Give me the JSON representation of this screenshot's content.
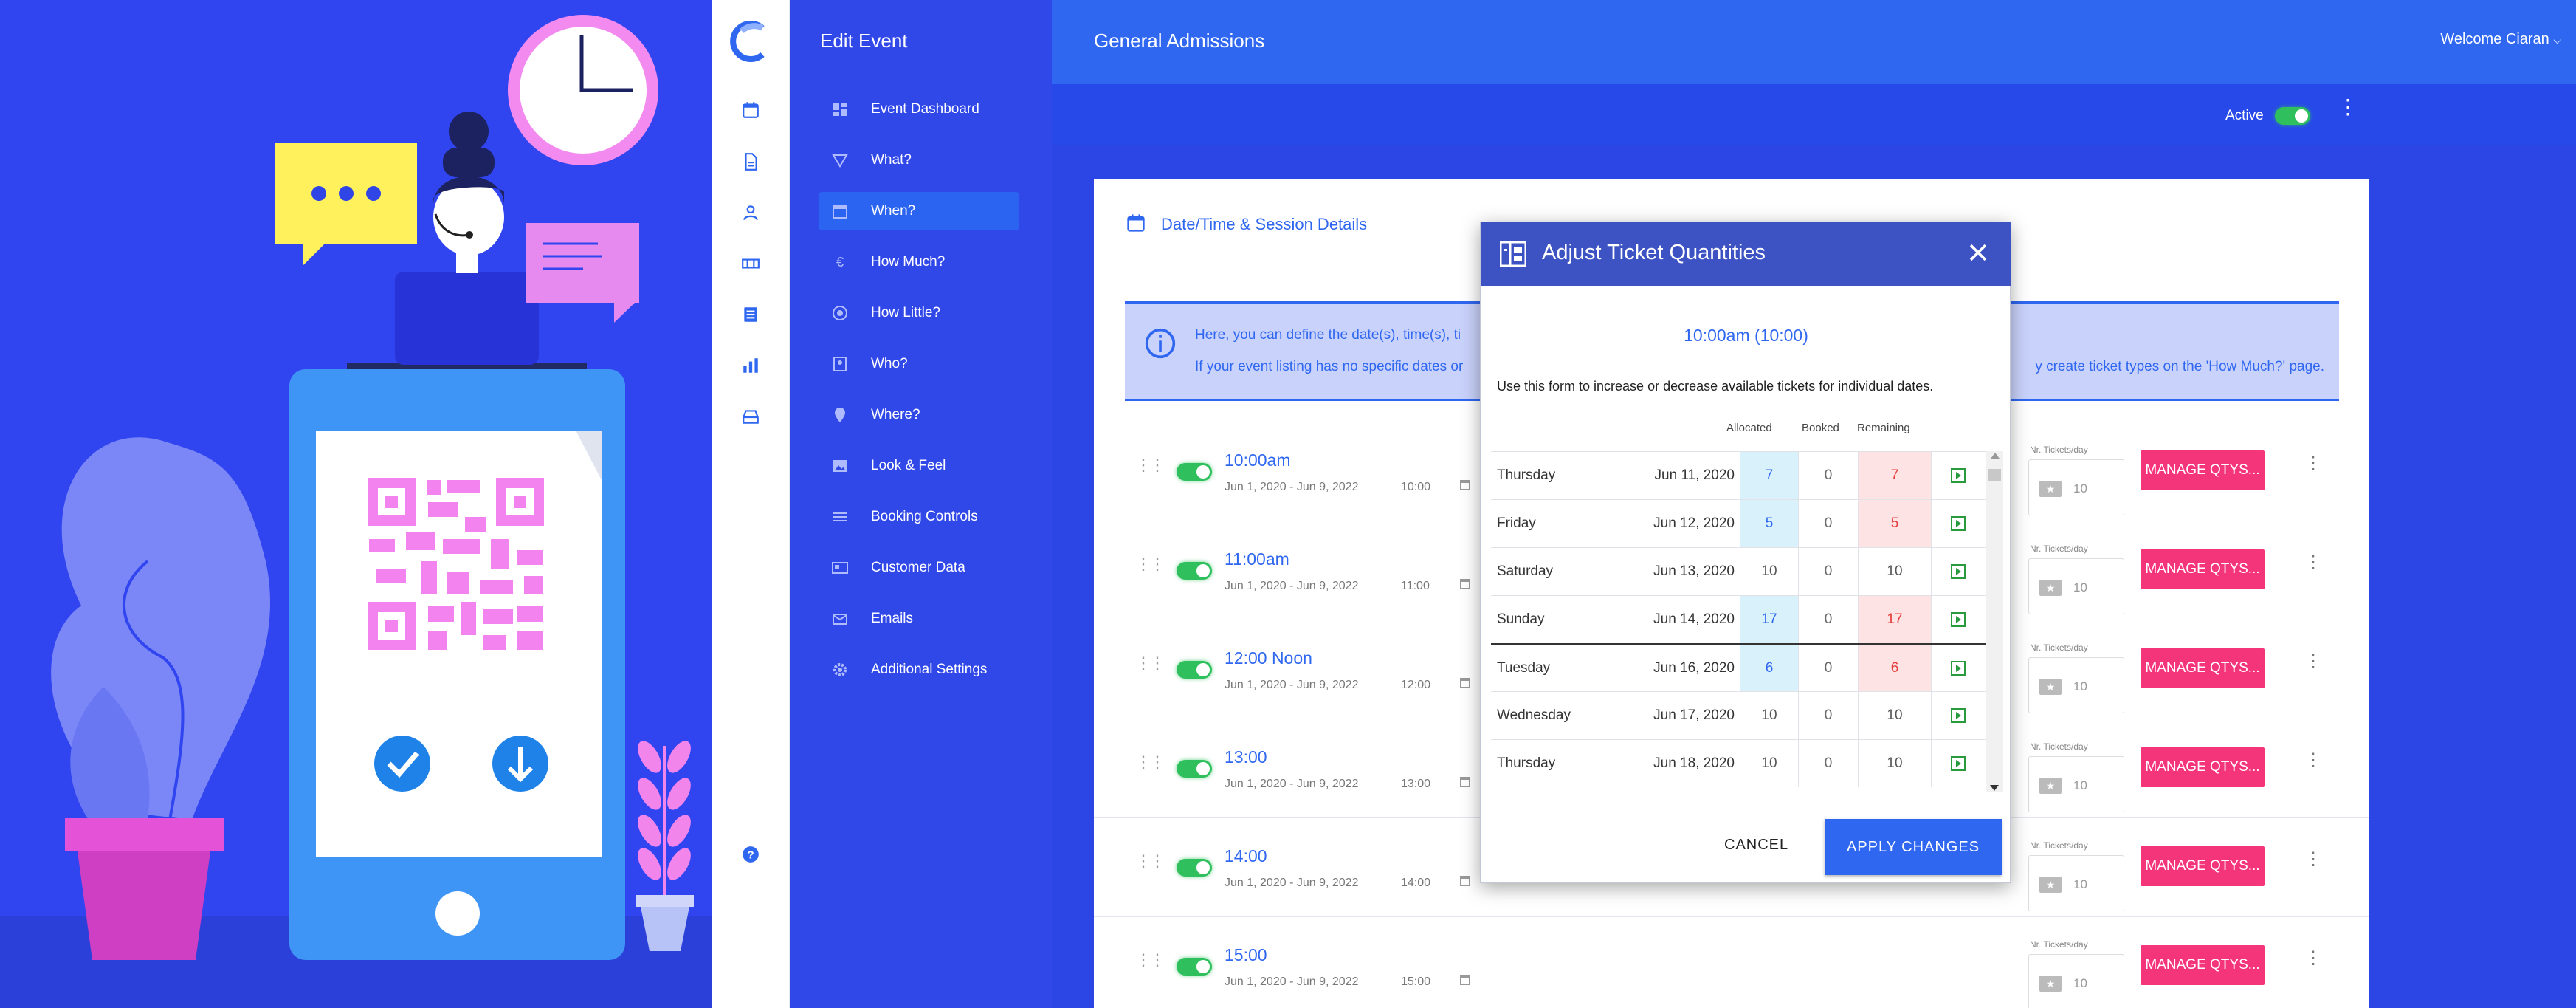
{
  "app": {
    "title": "General Admissions",
    "welcome": "Welcome Ciaran"
  },
  "nav": {
    "header": "Edit Event",
    "items": [
      {
        "label": "Event Dashboard",
        "icon": "dashboard-icon",
        "active": false
      },
      {
        "label": "What?",
        "icon": "triangle-icon",
        "active": false
      },
      {
        "label": "When?",
        "icon": "calendar-icon",
        "active": true
      },
      {
        "label": "How Much?",
        "icon": "euro-icon",
        "active": false
      },
      {
        "label": "How Little?",
        "icon": "badge-icon",
        "active": false
      },
      {
        "label": "Who?",
        "icon": "contact-icon",
        "active": false
      },
      {
        "label": "Where?",
        "icon": "pin-icon",
        "active": false
      },
      {
        "label": "Look & Feel",
        "icon": "image-icon",
        "active": false
      },
      {
        "label": "Booking Controls",
        "icon": "sliders-icon",
        "active": false
      },
      {
        "label": "Customer Data",
        "icon": "id-card-icon",
        "active": false
      },
      {
        "label": "Emails",
        "icon": "mail-icon",
        "active": false
      },
      {
        "label": "Additional Settings",
        "icon": "gear-icon",
        "active": false
      }
    ]
  },
  "status": {
    "label": "Active",
    "enabled": true
  },
  "section": {
    "title": "Date/Time & Session Details",
    "info_line1": "Here, you can define the date(s), time(s), ti",
    "info_line2": "If your event listing has no specific dates or",
    "info_line2_right": "y create ticket types on the 'How Much?' page."
  },
  "sessions": [
    {
      "name": "10:00am",
      "range": "Jun 1, 2020 - Jun 9, 2022",
      "time": "10:00",
      "tickets_label": "Nr. Tickets/day",
      "tickets": "10",
      "action": "MANAGE QTYS..."
    },
    {
      "name": "11:00am",
      "range": "Jun 1, 2020 - Jun 9, 2022",
      "time": "11:00",
      "tickets_label": "Nr. Tickets/day",
      "tickets": "10",
      "action": "MANAGE QTYS..."
    },
    {
      "name": "12:00 Noon",
      "range": "Jun 1, 2020 - Jun 9, 2022",
      "time": "12:00",
      "tickets_label": "Nr. Tickets/day",
      "tickets": "10",
      "action": "MANAGE QTYS..."
    },
    {
      "name": "13:00",
      "range": "Jun 1, 2020 - Jun 9, 2022",
      "time": "13:00",
      "tickets_label": "Nr. Tickets/day",
      "tickets": "10",
      "action": "MANAGE QTYS..."
    },
    {
      "name": "14:00",
      "range": "Jun 1, 2020 - Jun 9, 2022",
      "time": "14:00",
      "tickets_label": "Nr. Tickets/day",
      "tickets": "10",
      "action": "MANAGE QTYS..."
    },
    {
      "name": "15:00",
      "range": "Jun 1, 2020 - Jun 9, 2022",
      "time": "15:00",
      "tickets_label": "Nr. Tickets/day",
      "tickets": "10",
      "action": "MANAGE QTYS..."
    }
  ],
  "modal": {
    "title": "Adjust Ticket Quantities",
    "session": "10:00am (10:00)",
    "instructions": "Use this form to increase or decrease available tickets for individual dates.",
    "columns": {
      "allocated": "Allocated",
      "booked": "Booked",
      "remaining": "Remaining"
    },
    "rows": [
      {
        "day": "Thursday",
        "date": "Jun 11, 2020",
        "allocated": "7",
        "booked": "0",
        "remaining": "7",
        "state": "changed"
      },
      {
        "day": "Friday",
        "date": "Jun 12, 2020",
        "allocated": "5",
        "booked": "0",
        "remaining": "5",
        "state": "changed"
      },
      {
        "day": "Saturday",
        "date": "Jun 13, 2020",
        "allocated": "10",
        "booked": "0",
        "remaining": "10",
        "state": "normal"
      },
      {
        "day": "Sunday",
        "date": "Jun 14, 2020",
        "allocated": "17",
        "booked": "0",
        "remaining": "17",
        "state": "changed"
      },
      {
        "day": "Tuesday",
        "date": "Jun 16, 2020",
        "allocated": "6",
        "booked": "0",
        "remaining": "6",
        "state": "changed"
      },
      {
        "day": "Wednesday",
        "date": "Jun 17, 2020",
        "allocated": "10",
        "booked": "0",
        "remaining": "10",
        "state": "normal"
      },
      {
        "day": "Thursday",
        "date": "Jun 18, 2020",
        "allocated": "10",
        "booked": "0",
        "remaining": "10",
        "state": "normal"
      }
    ],
    "cancel": "CANCEL",
    "apply": "APPLY CHANGES"
  },
  "colors": {
    "accent": "#2f67f0",
    "pink": "#f5357a",
    "green": "#2fc05d",
    "modal_header": "#3d53c3"
  }
}
